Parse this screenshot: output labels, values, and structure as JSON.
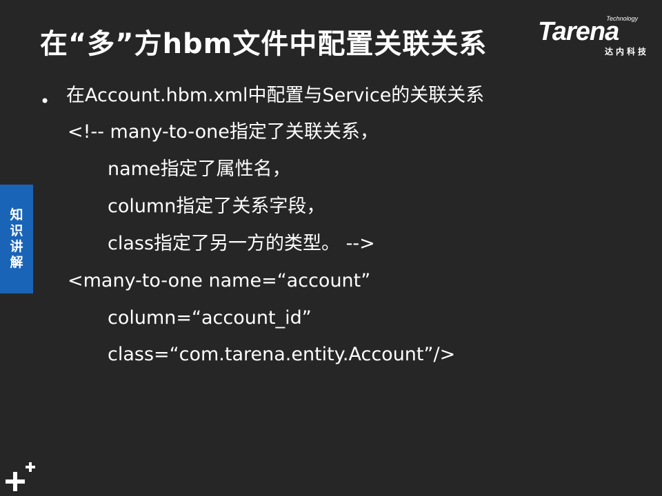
{
  "title": "在“多”方hbm文件中配置关联关系",
  "logo": {
    "technology": "Technology",
    "brand": "Tarena",
    "chinese": "达内科技"
  },
  "side_tab": {
    "chars": [
      "知",
      "识",
      "讲",
      "解"
    ],
    "color": "#1a64b8"
  },
  "bullet": {
    "symbol": "•",
    "heading": "在Account.hbm.xml中配置与Service的关联关系",
    "lines": [
      "<!-- many-to-one指定了关联关系，",
      "name指定了属性名，",
      "column指定了关系字段，",
      "class指定了另一方的类型。 -->",
      "<many-to-one name=“account”",
      "column=“account_id”",
      "class=“com.tarena.entity.Account”/>"
    ]
  },
  "colors": {
    "background": "#262626",
    "text": "#ffffff"
  },
  "corner_icon": "plus-decoration-icon"
}
